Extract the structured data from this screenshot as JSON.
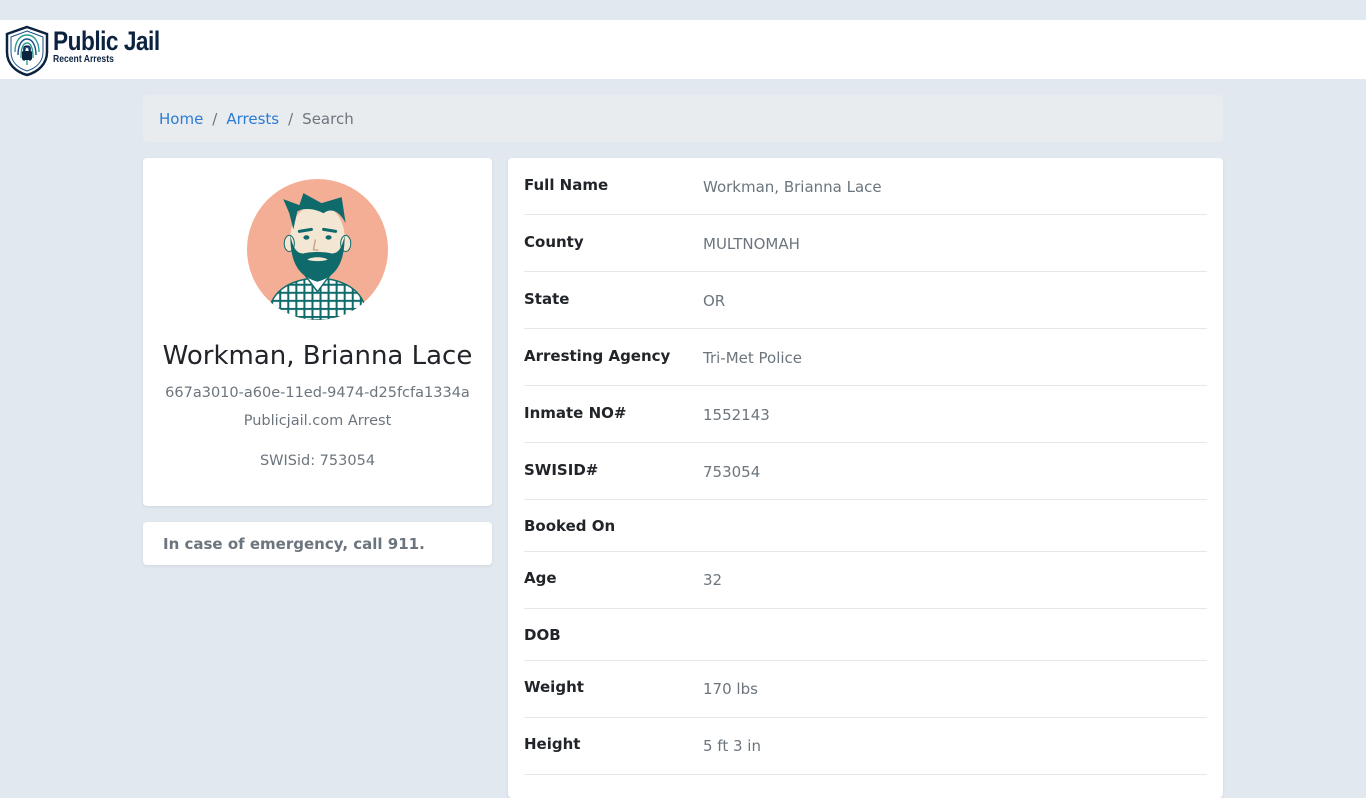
{
  "site": {
    "title": "Public Jail",
    "subtitle": "Recent Arrests"
  },
  "breadcrumb": {
    "home": "Home",
    "arrests": "Arrests",
    "current": "Search",
    "separator": "/"
  },
  "profile": {
    "name": "Workman, Brianna Lace",
    "id": "667a3010-a60e-11ed-9474-d25fcfa1334a",
    "source": "Publicjail.com Arrest",
    "swis": "SWISid: 753054",
    "avatar_icon": "bearded-man-avatar-icon"
  },
  "emergency": "In case of emergency, call 911.",
  "details": [
    {
      "label": "Full Name",
      "value": "Workman, Brianna Lace"
    },
    {
      "label": "County",
      "value": "MULTNOMAH"
    },
    {
      "label": "State",
      "value": "OR"
    },
    {
      "label": "Arresting Agency",
      "value": "Tri-Met Police"
    },
    {
      "label": "Inmate NO#",
      "value": "1552143"
    },
    {
      "label": "SWISID#",
      "value": "753054"
    },
    {
      "label": "Booked On",
      "value": ""
    },
    {
      "label": "Age",
      "value": "32"
    },
    {
      "label": "DOB",
      "value": ""
    },
    {
      "label": "Weight",
      "value": "170 lbs"
    },
    {
      "label": "Height",
      "value": "5 ft 3 in"
    }
  ],
  "colors": {
    "background": "#e2e8f0",
    "link": "#2b7bd3",
    "brand": "#0c2340",
    "avatar_bg": "#f4ae95",
    "avatar_teal": "#0f6b6b"
  }
}
